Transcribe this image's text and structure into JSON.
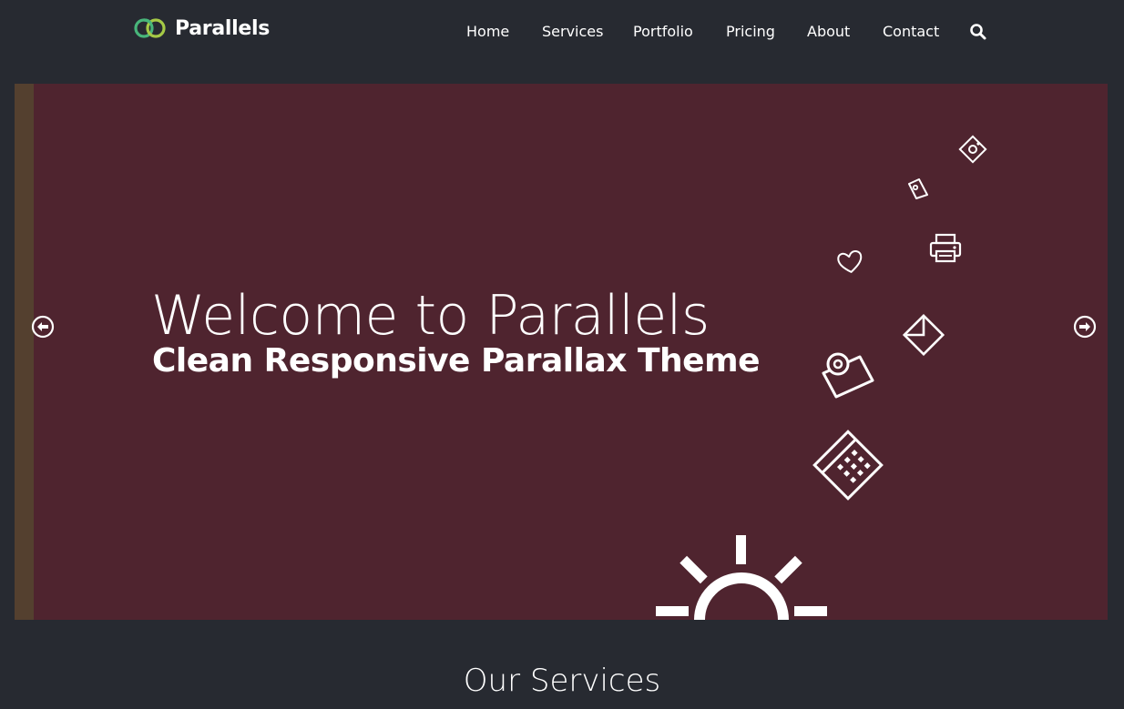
{
  "brand": {
    "name": "Parallels",
    "logo_icon": "linked-rings-icon",
    "logo_colors": [
      "#48b57a",
      "#a5c946"
    ]
  },
  "nav": {
    "items": [
      {
        "label": "Home"
      },
      {
        "label": "Services"
      },
      {
        "label": "Portfolio"
      },
      {
        "label": "Pricing"
      },
      {
        "label": "About"
      },
      {
        "label": "Contact"
      }
    ],
    "search_icon": "search-icon"
  },
  "hero": {
    "title": "Welcome to Parallels",
    "subtitle": "Clean Responsive Parallax Theme",
    "background_color": "#4f242f",
    "prev_icon": "arrow-left-circle-icon",
    "next_icon": "arrow-right-circle-icon",
    "decorative_icons": [
      "cd-icon",
      "tag-icon",
      "printer-icon",
      "heart-icon",
      "envelope-icon",
      "camera-icon",
      "calculator-icon",
      "sun-icon"
    ]
  },
  "services": {
    "title": "Our Services"
  }
}
